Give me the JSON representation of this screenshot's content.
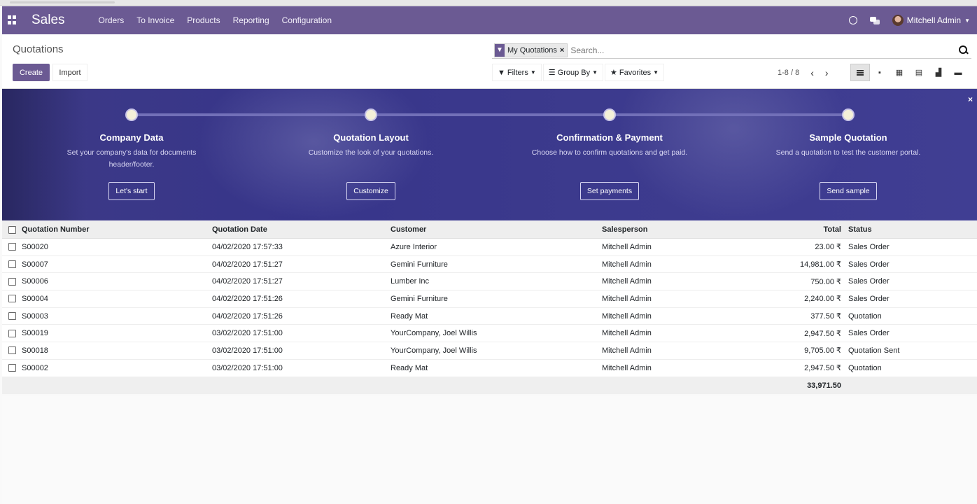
{
  "navbar": {
    "brand": "Sales",
    "menu": [
      "Orders",
      "To Invoice",
      "Products",
      "Reporting",
      "Configuration"
    ],
    "user_name": "Mitchell Admin"
  },
  "control": {
    "breadcrumb": "Quotations",
    "create_label": "Create",
    "import_label": "Import",
    "facet_label": "My Quotations",
    "facet_close": "×",
    "search_placeholder": "Search...",
    "filters_label": "Filters",
    "groupby_label": "Group By",
    "favorites_label": "Favorites",
    "pager": "1-8 / 8"
  },
  "banner": {
    "steps": [
      {
        "title": "Company Data",
        "desc": "Set your company's data for documents header/footer.",
        "button": "Let's start"
      },
      {
        "title": "Quotation Layout",
        "desc": "Customize the look of your quotations.",
        "button": "Customize"
      },
      {
        "title": "Confirmation & Payment",
        "desc": "Choose how to confirm quotations and get paid.",
        "button": "Set payments"
      },
      {
        "title": "Sample Quotation",
        "desc": "Send a quotation to test the customer portal.",
        "button": "Send sample"
      }
    ],
    "close": "×"
  },
  "table": {
    "headers": {
      "number": "Quotation Number",
      "date": "Quotation Date",
      "customer": "Customer",
      "salesperson": "Salesperson",
      "total": "Total",
      "status": "Status"
    },
    "rows": [
      {
        "number": "S00020",
        "date": "04/02/2020 17:57:33",
        "customer": "Azure Interior",
        "salesperson": "Mitchell Admin",
        "total": "23.00 ₹",
        "status": "Sales Order"
      },
      {
        "number": "S00007",
        "date": "04/02/2020 17:51:27",
        "customer": "Gemini Furniture",
        "salesperson": "Mitchell Admin",
        "total": "14,981.00 ₹",
        "status": "Sales Order"
      },
      {
        "number": "S00006",
        "date": "04/02/2020 17:51:27",
        "customer": "Lumber Inc",
        "salesperson": "Mitchell Admin",
        "total": "750.00 ₹",
        "status": "Sales Order"
      },
      {
        "number": "S00004",
        "date": "04/02/2020 17:51:26",
        "customer": "Gemini Furniture",
        "salesperson": "Mitchell Admin",
        "total": "2,240.00 ₹",
        "status": "Sales Order"
      },
      {
        "number": "S00003",
        "date": "04/02/2020 17:51:26",
        "customer": "Ready Mat",
        "salesperson": "Mitchell Admin",
        "total": "377.50 ₹",
        "status": "Quotation"
      },
      {
        "number": "S00019",
        "date": "03/02/2020 17:51:00",
        "customer": "YourCompany, Joel Willis",
        "salesperson": "Mitchell Admin",
        "total": "2,947.50 ₹",
        "status": "Sales Order"
      },
      {
        "number": "S00018",
        "date": "03/02/2020 17:51:00",
        "customer": "YourCompany, Joel Willis",
        "salesperson": "Mitchell Admin",
        "total": "9,705.00 ₹",
        "status": "Quotation Sent"
      },
      {
        "number": "S00002",
        "date": "03/02/2020 17:51:00",
        "customer": "Ready Mat",
        "salesperson": "Mitchell Admin",
        "total": "2,947.50 ₹",
        "status": "Quotation"
      }
    ],
    "footer_total": "33,971.50"
  },
  "colors": {
    "brand": "#6b5a93",
    "banner": "#3b398b"
  }
}
